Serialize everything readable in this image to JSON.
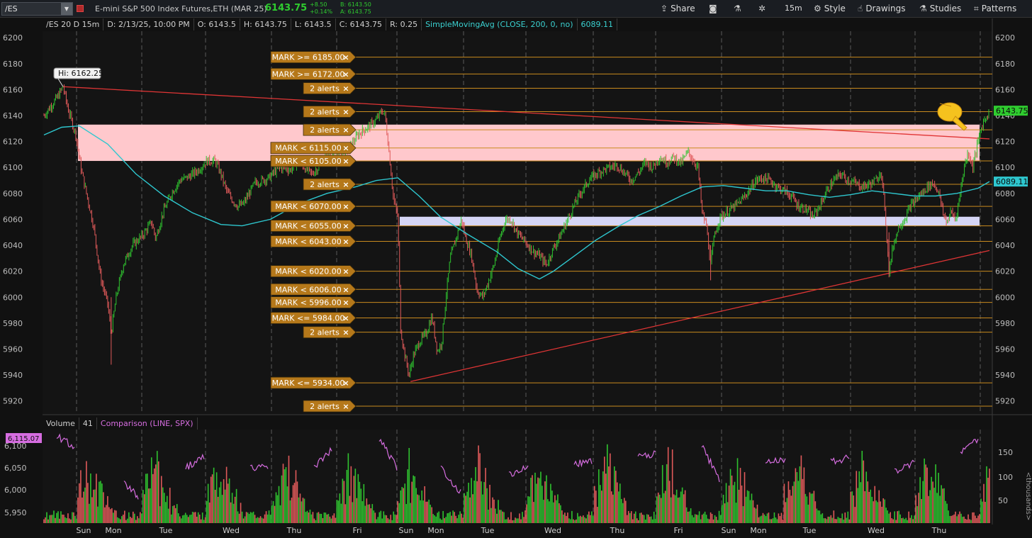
{
  "toolbar": {
    "symbol": "/ES",
    "description": "E-mini S&P 500 Index Futures,ETH (MAR 25)",
    "last": "6143.75",
    "change_abs": "+8.50",
    "change_pct": "+0.14%",
    "bid": "B: 6143.50",
    "ask": "A: 6143.75",
    "share_label": "Share",
    "timeframe": "15m",
    "style_label": "Style",
    "drawings_label": "Drawings",
    "studies_label": "Studies",
    "patterns_label": "Patterns",
    "accent_color": "#2fcc2f"
  },
  "header": {
    "title": "/ES 20 D 15m",
    "date": "D: 2/13/25, 10:00 PM",
    "open": "O: 6143.5",
    "high": "H: 6143.75",
    "low": "L: 6143.5",
    "close": "C: 6143.75",
    "range": "R: 0.25",
    "sma_label": "SimpleMovingAvg (CLOSE, 200, 0, no)",
    "sma_value": "6089.11"
  },
  "volume_header": {
    "label": "Volume",
    "value": "41",
    "comparison": "Comparison (LINE, SPX)"
  },
  "chart_data": {
    "type": "candlestick",
    "y_axis": {
      "min": 5910,
      "max": 6205,
      "ticks": [
        5920,
        5940,
        5960,
        5980,
        6000,
        6020,
        6040,
        6060,
        6080,
        6100,
        6120,
        6140,
        6160,
        6180,
        6200
      ]
    },
    "x_labels": [
      "Sun",
      "Mon",
      "Tue",
      "Wed",
      "Thu",
      "Fri",
      "Sun",
      "Mon",
      "Tue",
      "Wed",
      "Thu",
      "Fri",
      "Sun",
      "Mon",
      "Tue",
      "Wed",
      "Thu"
    ],
    "hi_label": "Hi: 6162.25",
    "last_price": 6143.75,
    "sma_last": 6089.11,
    "colors": {
      "up": "#2fc22f",
      "down": "#e05a5a",
      "sma": "#2ec7cf",
      "alert_line": "#c98a1e",
      "trendline": "#e03535",
      "pink_zone": "#ffc8cc",
      "lavender_zone": "#d5d5f5",
      "comparison": "#d66de0"
    },
    "price_path": [
      [
        0,
        6140
      ],
      [
        20,
        6155
      ],
      [
        27,
        6162.25
      ],
      [
        34,
        6145
      ],
      [
        45,
        6125
      ],
      [
        52,
        6100
      ],
      [
        60,
        6080
      ],
      [
        70,
        6055
      ],
      [
        80,
        6015
      ],
      [
        90,
        5995
      ],
      [
        95,
        5972
      ],
      [
        102,
        6000
      ],
      [
        112,
        6025
      ],
      [
        125,
        6040
      ],
      [
        140,
        6048
      ],
      [
        152,
        6058
      ],
      [
        158,
        6045
      ],
      [
        168,
        6065
      ],
      [
        180,
        6080
      ],
      [
        192,
        6090
      ],
      [
        205,
        6093
      ],
      [
        218,
        6098
      ],
      [
        230,
        6105
      ],
      [
        242,
        6105
      ],
      [
        250,
        6095
      ],
      [
        258,
        6082
      ],
      [
        266,
        6075
      ],
      [
        274,
        6070
      ],
      [
        282,
        6072
      ],
      [
        290,
        6080
      ],
      [
        298,
        6088
      ],
      [
        308,
        6090
      ],
      [
        318,
        6092
      ],
      [
        328,
        6098
      ],
      [
        338,
        6100
      ],
      [
        348,
        6098
      ],
      [
        358,
        6105
      ],
      [
        368,
        6100
      ],
      [
        378,
        6095
      ],
      [
        388,
        6100
      ],
      [
        398,
        6108
      ],
      [
        408,
        6110
      ],
      [
        418,
        6112
      ],
      [
        428,
        6114
      ],
      [
        435,
        6118
      ],
      [
        445,
        6126
      ],
      [
        455,
        6130
      ],
      [
        462,
        6133
      ],
      [
        470,
        6137
      ],
      [
        478,
        6144
      ],
      [
        482,
        6140
      ],
      [
        488,
        6110
      ],
      [
        494,
        6075
      ],
      [
        500,
        6062
      ],
      [
        504,
        5975
      ],
      [
        510,
        5955
      ],
      [
        516,
        5940
      ],
      [
        522,
        5955
      ],
      [
        530,
        5965
      ],
      [
        540,
        5972
      ],
      [
        548,
        5985
      ],
      [
        556,
        5958
      ],
      [
        562,
        5965
      ],
      [
        568,
        6000
      ],
      [
        574,
        6030
      ],
      [
        582,
        6045
      ],
      [
        590,
        6060
      ],
      [
        596,
        6045
      ],
      [
        604,
        6032
      ],
      [
        612,
        6005
      ],
      [
        620,
        6000
      ],
      [
        628,
        6012
      ],
      [
        636,
        6025
      ],
      [
        644,
        6045
      ],
      [
        652,
        6060
      ],
      [
        660,
        6060
      ],
      [
        668,
        6050
      ],
      [
        676,
        6045
      ],
      [
        684,
        6040
      ],
      [
        692,
        6035
      ],
      [
        700,
        6032
      ],
      [
        710,
        6025
      ],
      [
        720,
        6038
      ],
      [
        730,
        6048
      ],
      [
        740,
        6060
      ],
      [
        750,
        6072
      ],
      [
        760,
        6082
      ],
      [
        770,
        6090
      ],
      [
        780,
        6095
      ],
      [
        790,
        6098
      ],
      [
        800,
        6100
      ],
      [
        810,
        6102
      ],
      [
        820,
        6096
      ],
      [
        830,
        6090
      ],
      [
        840,
        6096
      ],
      [
        850,
        6104
      ],
      [
        860,
        6100
      ],
      [
        870,
        6108
      ],
      [
        880,
        6104
      ],
      [
        890,
        6108
      ],
      [
        900,
        6103
      ],
      [
        910,
        6112
      ],
      [
        918,
        6105
      ],
      [
        924,
        6100
      ],
      [
        930,
        6065
      ],
      [
        936,
        6055
      ],
      [
        942,
        6025
      ],
      [
        948,
        6050
      ],
      [
        956,
        6062
      ],
      [
        966,
        6066
      ],
      [
        976,
        6070
      ],
      [
        986,
        6075
      ],
      [
        996,
        6082
      ],
      [
        1006,
        6090
      ],
      [
        1016,
        6092
      ],
      [
        1026,
        6090
      ],
      [
        1036,
        6085
      ],
      [
        1046,
        6082
      ],
      [
        1056,
        6078
      ],
      [
        1066,
        6070
      ],
      [
        1076,
        6068
      ],
      [
        1086,
        6062
      ],
      [
        1096,
        6070
      ],
      [
        1106,
        6082
      ],
      [
        1116,
        6090
      ],
      [
        1126,
        6095
      ],
      [
        1136,
        6090
      ],
      [
        1146,
        6088
      ],
      [
        1156,
        6085
      ],
      [
        1166,
        6087
      ],
      [
        1176,
        6090
      ],
      [
        1182,
        6098
      ],
      [
        1188,
        6070
      ],
      [
        1194,
        6020
      ],
      [
        1200,
        6040
      ],
      [
        1208,
        6055
      ],
      [
        1216,
        6060
      ],
      [
        1224,
        6070
      ],
      [
        1232,
        6075
      ],
      [
        1240,
        6080
      ],
      [
        1248,
        6085
      ],
      [
        1256,
        6088
      ],
      [
        1264,
        6082
      ],
      [
        1270,
        6065
      ],
      [
        1276,
        6058
      ],
      [
        1282,
        6066
      ],
      [
        1288,
        6060
      ],
      [
        1294,
        6078
      ],
      [
        1300,
        6100
      ],
      [
        1306,
        6112
      ],
      [
        1312,
        6100
      ],
      [
        1318,
        6115
      ],
      [
        1324,
        6130
      ],
      [
        1330,
        6138
      ],
      [
        1336,
        6143.75
      ]
    ],
    "sma_path": [
      [
        0,
        6125
      ],
      [
        25,
        6131
      ],
      [
        50,
        6132
      ],
      [
        90,
        6118
      ],
      [
        130,
        6095
      ],
      [
        170,
        6078
      ],
      [
        210,
        6065
      ],
      [
        250,
        6056
      ],
      [
        280,
        6055
      ],
      [
        320,
        6060
      ],
      [
        360,
        6072
      ],
      [
        400,
        6080
      ],
      [
        440,
        6085
      ],
      [
        470,
        6090
      ],
      [
        500,
        6092
      ],
      [
        530,
        6078
      ],
      [
        560,
        6062
      ],
      [
        600,
        6048
      ],
      [
        640,
        6035
      ],
      [
        670,
        6022
      ],
      [
        700,
        6014
      ],
      [
        720,
        6020
      ],
      [
        750,
        6032
      ],
      [
        780,
        6044
      ],
      [
        810,
        6054
      ],
      [
        840,
        6063
      ],
      [
        870,
        6070
      ],
      [
        900,
        6078
      ],
      [
        930,
        6085
      ],
      [
        960,
        6086
      ],
      [
        990,
        6084
      ],
      [
        1020,
        6082
      ],
      [
        1050,
        6082
      ],
      [
        1080,
        6079
      ],
      [
        1110,
        6077
      ],
      [
        1140,
        6079
      ],
      [
        1170,
        6082
      ],
      [
        1200,
        6080
      ],
      [
        1230,
        6078
      ],
      [
        1260,
        6078
      ],
      [
        1290,
        6080
      ],
      [
        1320,
        6084
      ],
      [
        1336,
        6089.11
      ]
    ],
    "alerts": [
      {
        "label": "MARK >= 6185.00",
        "price": 6185.0
      },
      {
        "label": "MARK >= 6172.00",
        "price": 6172.0
      },
      {
        "label": "2 alerts",
        "price": 6161.0
      },
      {
        "label": "2 alerts",
        "price": 6143.0
      },
      {
        "label": "2 alerts",
        "price": 6129.0
      },
      {
        "label": "MARK < 6115.00",
        "price": 6115.0
      },
      {
        "label": "MARK < 6105.00",
        "price": 6105.0
      },
      {
        "label": "2 alerts",
        "price": 6087.0
      },
      {
        "label": "MARK < 6070.00",
        "price": 6070.0
      },
      {
        "label": "MARK < 6055.00",
        "price": 6055.0
      },
      {
        "label": "MARK < 6043.00",
        "price": 6043.0
      },
      {
        "label": "MARK < 6020.00",
        "price": 6020.0
      },
      {
        "label": "MARK < 6006.00",
        "price": 6006.0
      },
      {
        "label": "MARK < 5996.00",
        "price": 5996.0
      },
      {
        "label": "MARK <= 5984.00",
        "price": 5984.0
      },
      {
        "label": "2 alerts",
        "price": 5973.0
      },
      {
        "label": "MARK <= 5934.00",
        "price": 5934.0
      },
      {
        "label": "2 alerts",
        "price": 5916.0
      }
    ],
    "zones": [
      {
        "name": "pink-zone",
        "from": 6105,
        "to": 6133
      },
      {
        "name": "lavender-zone",
        "from": 6055,
        "to": 6062
      }
    ],
    "trendlines": [
      {
        "name": "resistance-trendline",
        "points": [
          [
            27,
            6162.25
          ],
          [
            1336,
            6122
          ]
        ]
      },
      {
        "name": "support-trendline",
        "points": [
          [
            518,
            5935
          ],
          [
            1336,
            6036
          ]
        ]
      }
    ],
    "volume_axis": {
      "ticks": [
        50,
        100,
        150
      ],
      "unit": "<thousands>"
    },
    "comparison_axis": {
      "ticks": [
        "5,950",
        "6,000",
        "6,050",
        "6,100"
      ],
      "last": "6,115.07"
    }
  }
}
